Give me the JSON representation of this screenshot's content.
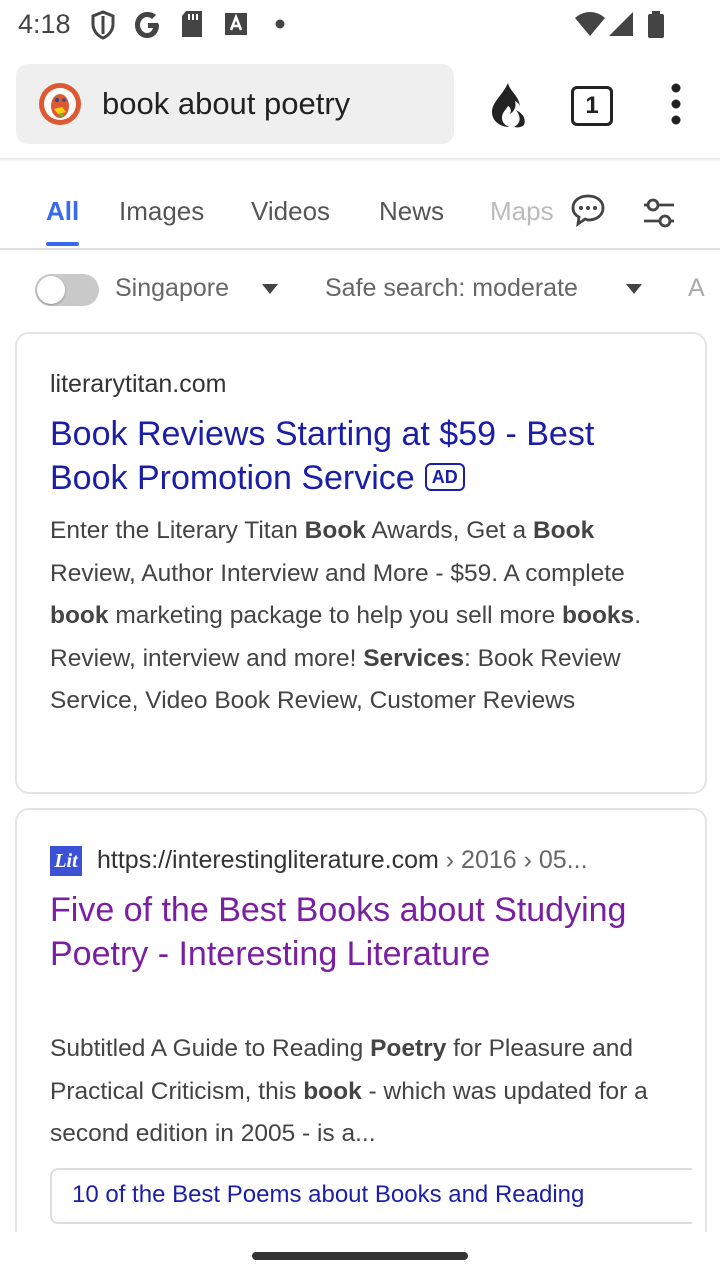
{
  "status_bar": {
    "time": "4:18",
    "left_icons": [
      "shield-icon",
      "google-icon",
      "sd-card-icon",
      "translate-icon",
      "dot-icon"
    ],
    "right_icons": [
      "wifi-icon",
      "signal-icon",
      "battery-icon"
    ]
  },
  "browser": {
    "url_text": "book about poetry",
    "tab_count": "1",
    "icons": [
      "duckduckgo-logo",
      "fire-icon",
      "tabs-icon",
      "more-vert-icon"
    ]
  },
  "nav": {
    "tabs": [
      "All",
      "Images",
      "Videos",
      "News",
      "Maps"
    ],
    "active_tab": "All",
    "accent_color": "#3969ef"
  },
  "filters": {
    "region": "Singapore",
    "safe_search": "Safe search: moderate",
    "more": "A",
    "region_toggle_on": false
  },
  "results": [
    {
      "domain": "literarytitan.com",
      "title": "Book Reviews Starting at $59 - Best Book Promotion Service",
      "badge": "AD",
      "snippet_html": "Enter the Literary Titan <b>Book</b> Awards, Get a <b>Book</b> Review, Author Interview and More - $59. A complete <b>book</b> marketing package to help you sell more <b>books</b>. Review, interview and more! <b>Services</b>: Book Review Service, Video Book Review, Customer Reviews"
    },
    {
      "favicon_text": "Lit",
      "url": "https://interestingliterature.com",
      "url_crumbs": " › 2016 › 05...",
      "title": "Five of the Best Books about Studying Poetry - Interesting Literature",
      "snippet_html": "Subtitled A Guide to Reading <b>Poetry</b> for Pleasure and Practical Criticism, this <b>book</b> - which was updated for a second edition in 2005 - is a...",
      "sitelink": "10 of the Best Poems about Books and Reading"
    }
  ]
}
